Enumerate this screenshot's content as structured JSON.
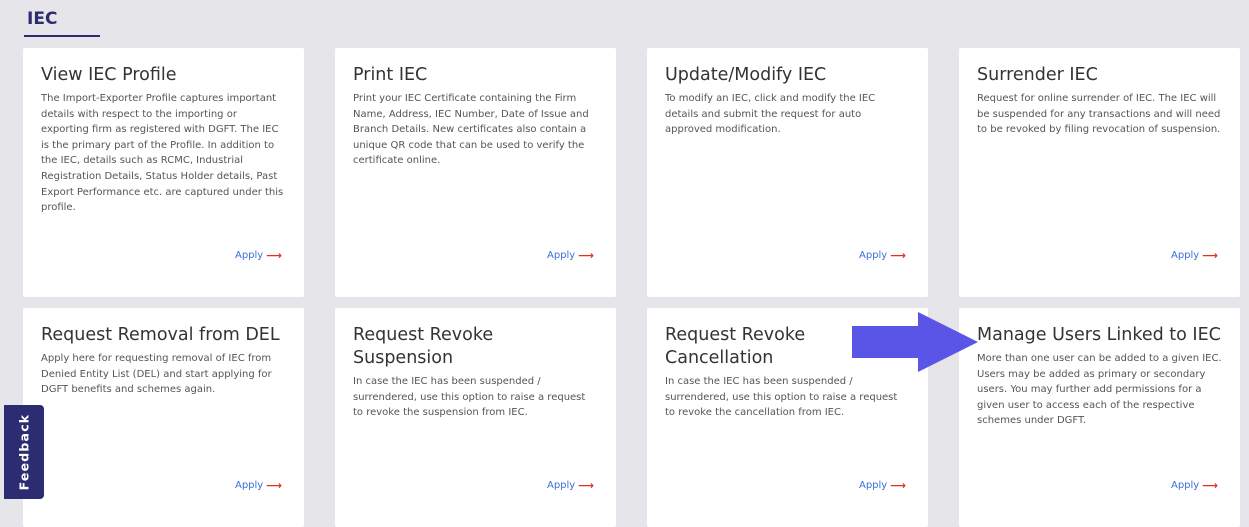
{
  "section": {
    "title": "IEC"
  },
  "cards": [
    {
      "title": "View IEC Profile",
      "description": "The Import-Exporter Profile captures important details with respect to the importing or exporting firm as registered with DGFT. The IEC is the primary part of the Profile. In addition to the IEC, details such as RCMC, Industrial Registration Details, Status Holder details, Past Export Performance etc. are captured under this profile.",
      "apply": "Apply"
    },
    {
      "title": "Print IEC",
      "description": "Print your IEC Certificate containing the Firm Name, Address, IEC Number, Date of Issue and Branch Details. New certificates also contain a unique QR code that can be used to verify the certificate online.",
      "apply": "Apply"
    },
    {
      "title": "Update/Modify IEC",
      "description": "To modify an IEC, click and modify the IEC details and submit the request for auto approved modification.",
      "apply": "Apply"
    },
    {
      "title": "Surrender IEC",
      "description": "Request for online surrender of IEC. The IEC will be suspended for any transactions and will need to be revoked by filing revocation of suspension.",
      "apply": "Apply"
    },
    {
      "title": "Request Removal from DEL",
      "description": "Apply here for requesting removal of IEC from Denied Entity List (DEL) and start applying for DGFT benefits and schemes again.",
      "apply": "Apply"
    },
    {
      "title": "Request Revoke Suspension",
      "description": "In case the IEC has been suspended / surrendered, use this option to raise a request to revoke the suspension from IEC.",
      "apply": "Apply"
    },
    {
      "title": "Request Revoke Cancellation",
      "description": "In case the IEC has been suspended / surrendered, use this option to raise a request to revoke the cancellation from IEC.",
      "apply": "Apply"
    },
    {
      "title": "Manage Users Linked to IEC",
      "description": "More than one user can be added to a given IEC. Users may be added as primary or secondary users. You may further add permissions for a given user to access each of the respective schemes under DGFT.",
      "apply": "Apply"
    }
  ],
  "feedback": {
    "label": "Feedback"
  },
  "icons": {
    "apply_arrow": "arrow-right-icon",
    "pointer": "big-arrow-pointer-icon"
  },
  "colors": {
    "background": "#e5e5ea",
    "accent": "#2c2c72",
    "link": "#3a6fd8",
    "apply_arrow": "#e0301e",
    "pointer_arrow": "#5a55e6"
  }
}
